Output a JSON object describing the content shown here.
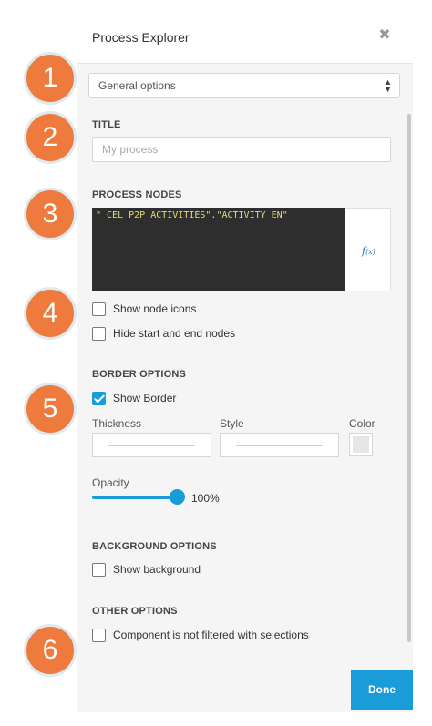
{
  "panel": {
    "title": "Process Explorer",
    "close_glyph": "✖",
    "dropdown": {
      "selected": "General options",
      "arrows": "▲▼"
    }
  },
  "title_section": {
    "label": "TITLE",
    "placeholder": "My process"
  },
  "process_nodes": {
    "label": "PROCESS NODES",
    "expression": "\"_CEL_P2P_ACTIVITIES\".\"ACTIVITY_EN\"",
    "fx_icon": "f(x)"
  },
  "node_options": {
    "show_node_icons": {
      "label": "Show node icons",
      "checked": false
    },
    "hide_start_end": {
      "label": "Hide start and end nodes",
      "checked": false
    }
  },
  "border_options": {
    "label": "BORDER OPTIONS",
    "show_border": {
      "label": "Show Border",
      "checked": true
    },
    "thickness_label": "Thickness",
    "style_label": "Style",
    "color_label": "Color",
    "swatch_color": "#e6e6e6",
    "opacity_label": "Opacity",
    "opacity_value": "100%"
  },
  "background_options": {
    "label": "BACKGROUND OPTIONS",
    "show_background": {
      "label": "Show background",
      "checked": false
    }
  },
  "other_options": {
    "label": "OTHER OPTIONS",
    "not_filtered": {
      "label": "Component is not filtered with selections",
      "checked": false
    }
  },
  "footer": {
    "done_label": "Done"
  },
  "badges": [
    "1",
    "2",
    "3",
    "4",
    "5",
    "6"
  ],
  "colors": {
    "accent": "#1a9cd8",
    "badge": "#ee7b3d",
    "code_bg": "#2e2e2e",
    "code_text": "#e6db74"
  }
}
